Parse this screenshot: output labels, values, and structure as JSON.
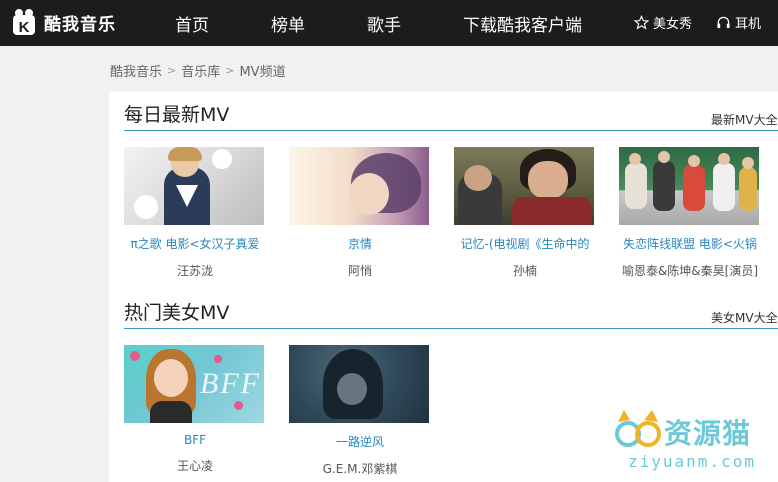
{
  "header": {
    "logo_text": "酷我音乐",
    "nav": [
      "首页",
      "榜单",
      "歌手",
      "下载酷我客户端"
    ],
    "right": [
      {
        "label": "美女秀",
        "icon": "star-icon"
      },
      {
        "label": "耳机",
        "icon": "headphones-icon"
      }
    ]
  },
  "breadcrumb": [
    "酷我音乐",
    "音乐库",
    "MV频道"
  ],
  "breadcrumb_sep": ">",
  "sections": [
    {
      "title": "每日最新MV",
      "more": "最新MV大全",
      "items": [
        {
          "title": "π之歌 电影<女汉子真爱",
          "artist": "汪苏泷"
        },
        {
          "title": "京情",
          "artist": "阿悄"
        },
        {
          "title": "记忆-(电视剧《生命中的",
          "artist": "孙楠"
        },
        {
          "title": "失恋阵线联盟 电影<火锅",
          "artist": "喻恩泰&陈坤&秦昊[演员]"
        }
      ]
    },
    {
      "title": "热门美女MV",
      "more": "美女MV大全",
      "items": [
        {
          "title": "BFF",
          "artist": "王心凌"
        },
        {
          "title": "一路逆风",
          "artist": "G.E.M.邓紫棋"
        }
      ]
    }
  ],
  "watermark": {
    "title": "资源猫",
    "sub": "ziyuanm.com"
  },
  "colors": {
    "topbar": "#1c1c1c",
    "accent": "#2a86c0",
    "line": "#3a94c6"
  }
}
